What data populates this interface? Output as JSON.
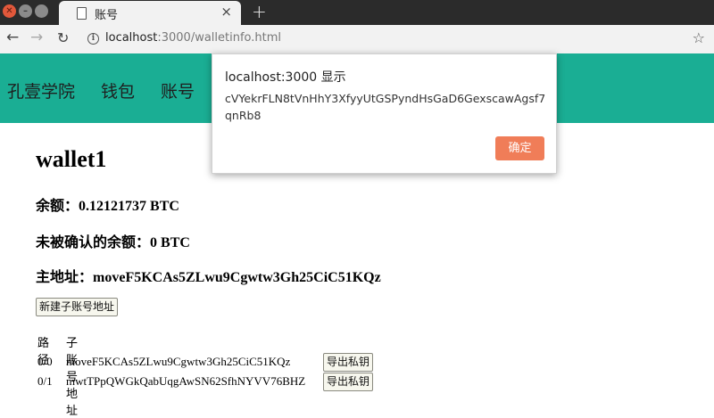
{
  "browser": {
    "tab_title": "账号",
    "tab_close": "×",
    "new_tab": "+",
    "url_host": "localhost",
    "url_rest": ":3000/walletinfo.html",
    "info_symbol": "i"
  },
  "navbar": {
    "brand": "孔壹学院",
    "links": [
      "钱包",
      "账号"
    ]
  },
  "wallet": {
    "name": "wallet1",
    "balance_label": "余额：",
    "balance_value": "0.12121737 BTC",
    "unconfirmed_label": "未被确认的余额：",
    "unconfirmed_value": "0 BTC",
    "main_address_label": "主地址：",
    "main_address_value": "moveF5KCAs5ZLwu9Cgwtw3Gh25CiC51KQz",
    "new_sub_account_button": "新建子账号地址"
  },
  "accounts_table": {
    "headers": [
      "路径",
      "子账号地址"
    ],
    "rows": [
      {
        "path": "0/0",
        "address": "moveF5KCAs5ZLwu9Cgwtw3Gh25CiC51KQz",
        "action": "导出私钥"
      },
      {
        "path": "0/1",
        "address": "mwtTPpQWGkQabUqgAwSN62SfhNYVV76BHZ",
        "action": "导出私钥"
      }
    ]
  },
  "alert": {
    "title": "localhost:3000 显示",
    "message": "cVYekrFLN8tVnHhY3XfyyUtGSPyndHsGaD6GexscawAgsf7qnRb8",
    "ok_label": "确定"
  },
  "colors": {
    "navbar_bg": "#1aae94",
    "ok_button_bg": "#f07d58",
    "titlebar_bg": "#2b2b2b"
  }
}
